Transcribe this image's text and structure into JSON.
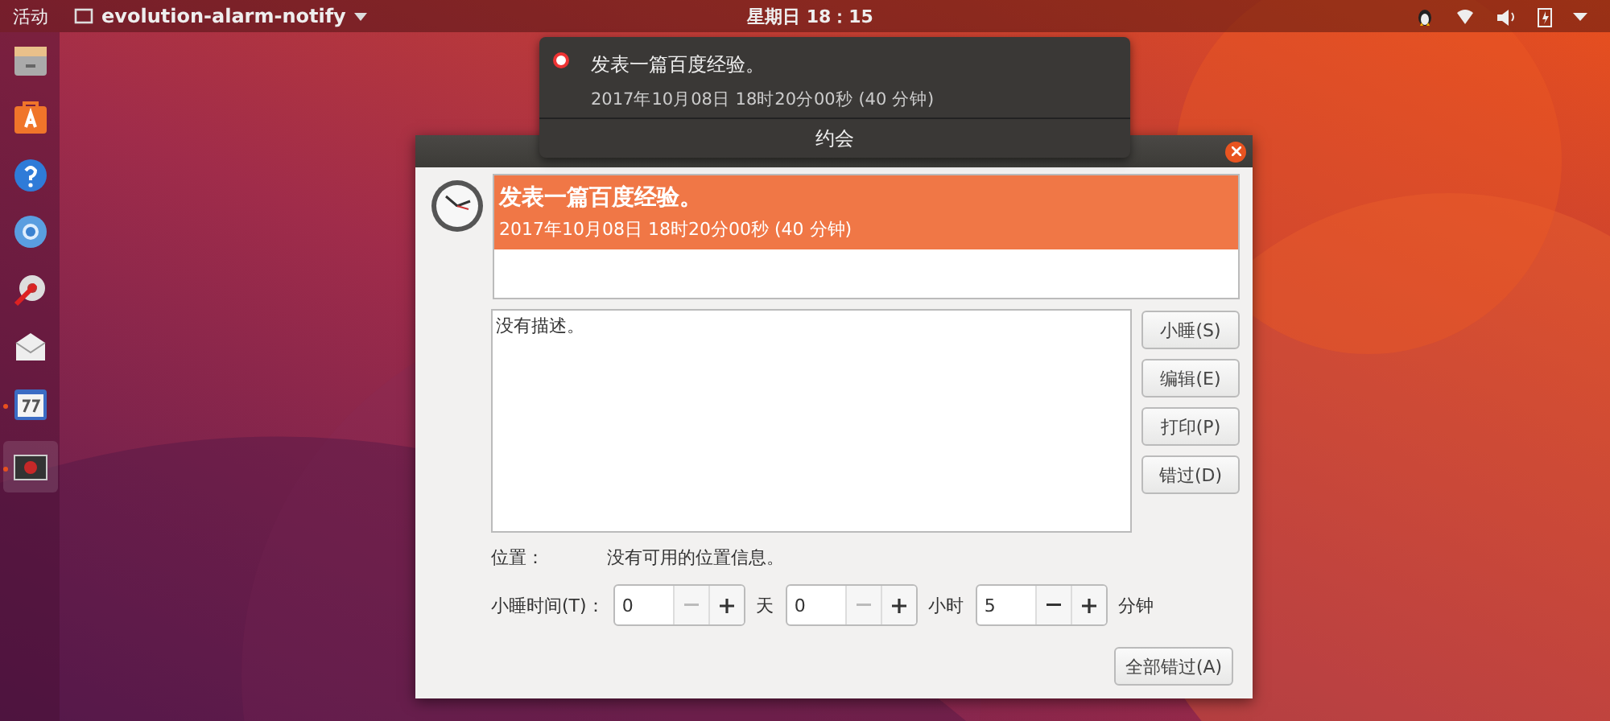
{
  "top_bar": {
    "activities": "活动",
    "app_menu": "evolution-alarm-notify",
    "clock": "星期日 18：15"
  },
  "dock": [
    {
      "kind": "files",
      "running": false,
      "selected": false
    },
    {
      "kind": "software",
      "running": false,
      "selected": false
    },
    {
      "kind": "help",
      "running": false,
      "selected": false
    },
    {
      "kind": "browser",
      "running": false,
      "selected": false
    },
    {
      "kind": "tools",
      "running": false,
      "selected": false
    },
    {
      "kind": "mail",
      "running": false,
      "selected": false
    },
    {
      "kind": "calendar",
      "running": true,
      "selected": false
    },
    {
      "kind": "window",
      "running": true,
      "selected": true
    }
  ],
  "notification": {
    "title": "发表一篇百度经验。",
    "time": "2017年10月08日 18时20分00秒 (40 分钟)",
    "action": "约会"
  },
  "dialog": {
    "alarms": [
      {
        "title": "发表一篇百度经验。",
        "time": "2017年10月08日 18时20分00秒 (40 分钟)",
        "selected": true
      }
    ],
    "description": "没有描述。",
    "buttons": [
      "小睡(S)",
      "编辑(E)",
      "打印(P)",
      "错过(D)"
    ],
    "location_label": "位置：",
    "location_value": "没有可用的位置信息。",
    "snooze_label": "小睡时间(T)：",
    "spinners": [
      {
        "value": "0",
        "unit": "天",
        "minus_disabled": true
      },
      {
        "value": "0",
        "unit": "小时",
        "minus_disabled": true
      },
      {
        "value": "5",
        "unit": "分钟",
        "minus_disabled": false
      }
    ],
    "dismiss_all": "全部错过(A)"
  }
}
